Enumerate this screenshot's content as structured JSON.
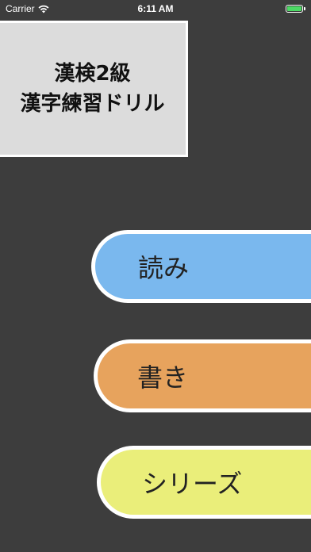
{
  "status_bar": {
    "carrier": "Carrier",
    "time": "6:11 AM",
    "wifi_icon": "wifi-icon",
    "battery_icon": "battery-icon",
    "battery_color": "#4cd964"
  },
  "title_panel": {
    "line1": "漢検2級",
    "line2": "漢字練習ドリル"
  },
  "menu": {
    "reading_label": "読み",
    "writing_label": "書き",
    "series_label": "シリーズ"
  },
  "colors": {
    "background": "#3d3d3d",
    "title_panel": "#dcdcdc",
    "reading": "#7ab8ee",
    "writing": "#e7a35d",
    "series": "#eaee7a"
  }
}
